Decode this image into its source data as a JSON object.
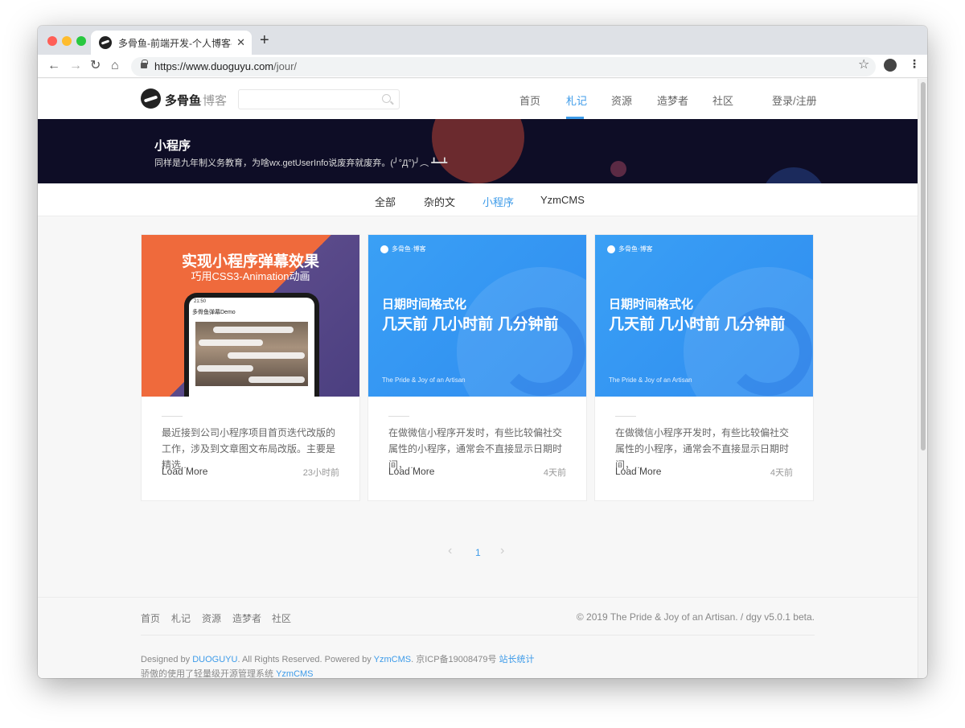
{
  "browser": {
    "tab_title": "多骨鱼-前端开发-个人博客-模版",
    "tab_close": "✕",
    "new_tab": "+",
    "url_host": "https://www.duoguyu.com",
    "url_path": "/jour/",
    "back": "←",
    "forward": "→",
    "reload": "↻",
    "home": "⌂",
    "star": "☆",
    "menu": "⋮"
  },
  "site": {
    "logo_text": "多骨鱼",
    "logo_sub": "·博客",
    "nav": [
      "首页",
      "札记",
      "资源",
      "造梦者",
      "社区"
    ],
    "nav_active_index": 1,
    "login": "登录/注册"
  },
  "banner": {
    "title": "小程序",
    "desc": "同样是九年制义务教育，为啥wx.getUserInfo说废弃就废弃。(╯°Д°)╯︵ ┻━┻"
  },
  "categories": [
    "全部",
    "杂的文",
    "小程序",
    "YzmCMS"
  ],
  "category_active_index": 2,
  "cards": [
    {
      "thumb_title": "实现小程序弹幕效果",
      "thumb_sub": "巧用CSS3-Animation动画",
      "phone_status": "21:50",
      "phone_nav": "多骨鱼弹幕Demo",
      "excerpt": "最近接到公司小程序项目首页迭代改版的工作，涉及到文章图文布局改版。主要是精选...",
      "more": "Load More",
      "time": "23小时前"
    },
    {
      "thumb_logo": "多骨鱼·博客",
      "thumb_title": "日期时间格式化",
      "thumb_sub": "几天前 几小时前 几分钟前",
      "thumb_foot": "The Pride & Joy of an Artisan",
      "excerpt": "在做微信小程序开发时，有些比较偏社交属性的小程序，通常会不直接显示日期时间，...",
      "more": "Load More",
      "time": "4天前"
    },
    {
      "thumb_logo": "多骨鱼·博客",
      "thumb_title": "日期时间格式化",
      "thumb_sub": "几天前 几小时前 几分钟前",
      "thumb_foot": "The Pride & Joy of an Artisan",
      "excerpt": "在做微信小程序开发时，有些比较偏社交属性的小程序，通常会不直接显示日期时间，...",
      "more": "Load More",
      "time": "4天前"
    }
  ],
  "pagination": {
    "prev": "‹",
    "current": "1",
    "next": "›"
  },
  "footer": {
    "nav": [
      "首页",
      "札记",
      "资源",
      "造梦者",
      "社区"
    ],
    "copyright": "© 2019 The Pride & Joy of an Artisan. / dgy v5.0.1 beta.",
    "line1_a": "Designed by ",
    "line1_link1": "DUOGUYU",
    "line1_b": ". All Rights Reserved. Powered by ",
    "line1_link2": "YzmCMS",
    "line1_c": ". 京ICP备19008479号 ",
    "line1_link3": "站长统计",
    "line2_a": "骄傲的使用了轻量级开源管理系统 ",
    "line2_link": "YzmCMS"
  },
  "colors": {
    "accent": "#3d9be9",
    "banner_bg": "#0e0d26",
    "card_blue": "#2f8cf0",
    "card_orange": "#ef6a3c"
  }
}
